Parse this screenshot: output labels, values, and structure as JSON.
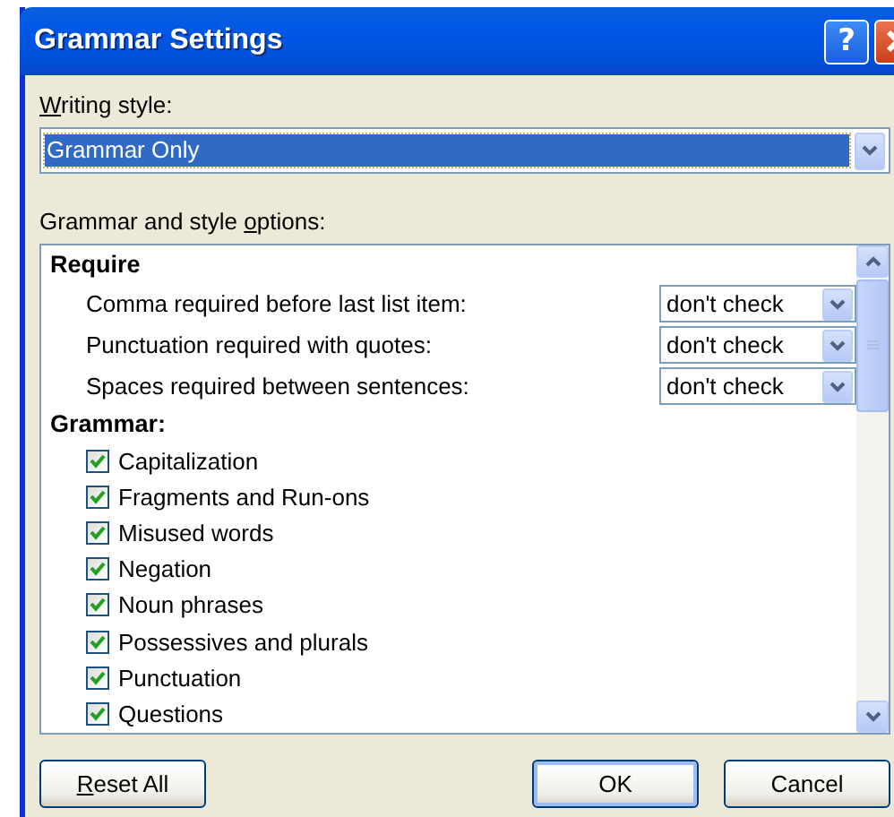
{
  "window": {
    "title": "Grammar Settings",
    "title_buttons": [
      {
        "kind": "help",
        "label": "?"
      },
      {
        "kind": "close"
      }
    ]
  },
  "writing_style": {
    "label_key": "W",
    "label_after": "riting style:",
    "value": "Grammar Only"
  },
  "options": {
    "label_before": "Grammar and style ",
    "label_key": "o",
    "label_after": "ptions:",
    "sections": [
      {
        "heading": "Require",
        "items": [
          {
            "kind": "dropdown",
            "label": "Comma required before last list item:",
            "value": "don't check"
          },
          {
            "kind": "dropdown",
            "label": "Punctuation required with quotes:",
            "value": "don't check"
          },
          {
            "kind": "dropdown",
            "label": "Spaces required between sentences:",
            "value": "don't check"
          }
        ]
      },
      {
        "heading": "Grammar:",
        "items": [
          {
            "kind": "checkbox",
            "label": "Capitalization",
            "checked": true
          },
          {
            "kind": "checkbox",
            "label": "Fragments and Run-ons",
            "checked": true
          },
          {
            "kind": "checkbox",
            "label": "Misused words",
            "checked": true
          },
          {
            "kind": "checkbox",
            "label": "Negation",
            "checked": true
          },
          {
            "kind": "checkbox",
            "label": "Noun phrases",
            "checked": true
          },
          {
            "kind": "checkbox",
            "label": "Possessives and plurals",
            "checked": true
          },
          {
            "kind": "checkbox",
            "label": "Punctuation",
            "checked": true
          },
          {
            "kind": "checkbox",
            "label": "Questions",
            "checked": true
          }
        ]
      }
    ]
  },
  "buttons_left": [
    {
      "label_key": "R",
      "label_after": "eset All",
      "default": false
    }
  ],
  "buttons_right": [
    {
      "label_after": "OK",
      "default": true
    },
    {
      "label_after": "Cancel",
      "default": false
    }
  ]
}
